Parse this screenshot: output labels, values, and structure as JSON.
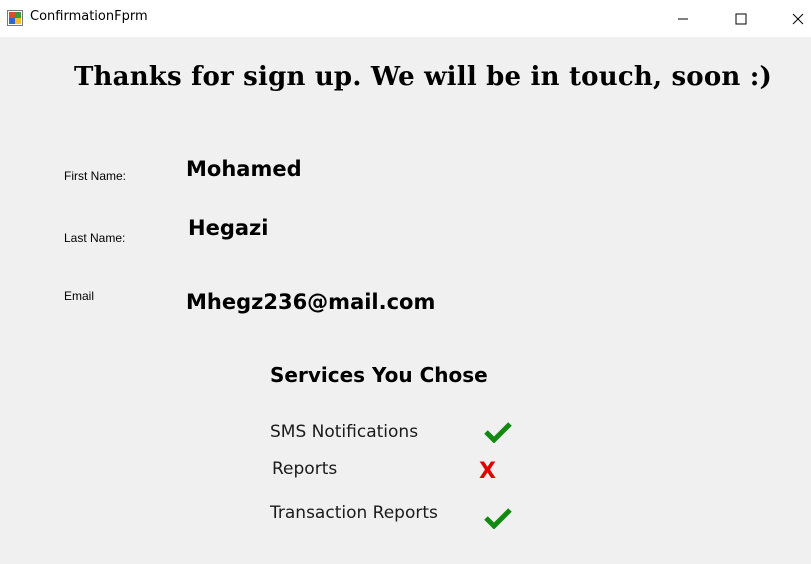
{
  "window": {
    "title": "ConfirmationFprm",
    "app_icon": "windows-form-icon",
    "controls": [
      "minimize-icon",
      "maximize-icon",
      "close-icon"
    ]
  },
  "headline": "Thanks for sign up. We will be in touch, soon :)",
  "fields": {
    "first_name_label": "First Name:",
    "first_name_value": "Mohamed",
    "last_name_label": "Last Name:",
    "last_name_value": "Hegazi",
    "email_label": "Email",
    "email_value": "Mhegz236@mail.com"
  },
  "services": {
    "title": "Services You Chose",
    "items": [
      {
        "label": "SMS Notifications",
        "status": "check-icon",
        "mark": "",
        "color": "#128a12"
      },
      {
        "label": "Reports",
        "status": "cross-icon",
        "mark": "X",
        "color": "#e00000"
      },
      {
        "label": "Transaction Reports",
        "status": "check-icon",
        "mark": "",
        "color": "#128a12"
      }
    ]
  }
}
